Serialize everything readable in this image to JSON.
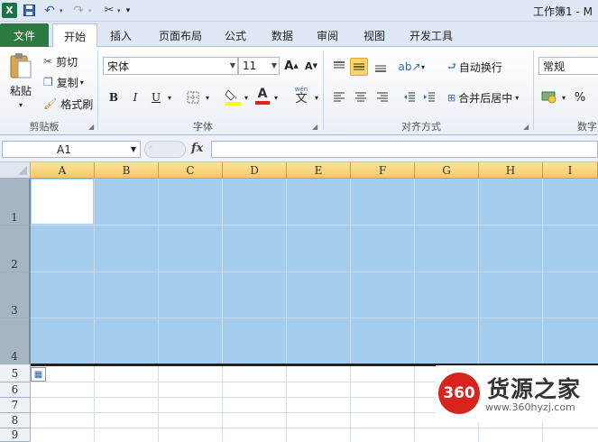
{
  "titlebar": {
    "app_icon": "X",
    "save_icon": "save-icon",
    "undo_icon": "undo-icon",
    "redo_icon": "redo-icon",
    "document_title": "工作簿1 - M"
  },
  "tabs": {
    "file": "文件",
    "items": [
      "开始",
      "插入",
      "页面布局",
      "公式",
      "数据",
      "审阅",
      "视图",
      "开发工具"
    ]
  },
  "ribbon": {
    "clipboard": {
      "paste": "粘贴",
      "cut": "剪切",
      "copy": "复制",
      "format_painter": "格式刷",
      "group_label": "剪贴板"
    },
    "font": {
      "font_name": "宋体",
      "font_size": "11",
      "bold": "B",
      "italic": "I",
      "underline": "U",
      "font_color_glyph": "A",
      "wen": "wén",
      "group_label": "字体"
    },
    "alignment": {
      "wrap_text": "自动换行",
      "merge_center": "合并后居中",
      "group_label": "对齐方式"
    },
    "number": {
      "format": "常规",
      "percent": "%",
      "group_label": "数字"
    }
  },
  "formula_bar": {
    "name_box": "A1",
    "fx": "fx",
    "formula": ""
  },
  "grid": {
    "columns": [
      "A",
      "B",
      "C",
      "D",
      "E",
      "F",
      "G",
      "H",
      "I"
    ],
    "rows": [
      "1",
      "2",
      "3",
      "4",
      "5",
      "6",
      "7",
      "8",
      "9"
    ],
    "selection_color": "#a4cdee",
    "active_cell": "A1"
  },
  "watermark": {
    "logo_text": "360",
    "name": "货源之家",
    "url": "www.360hyzj.com"
  }
}
